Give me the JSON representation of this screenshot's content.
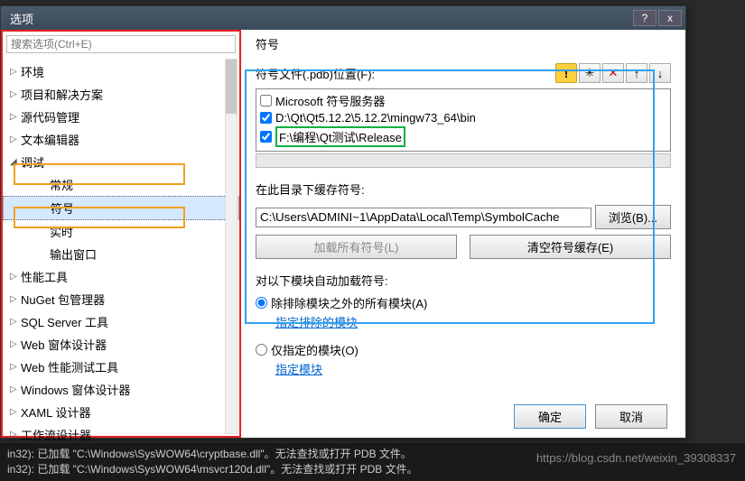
{
  "dialog": {
    "title": "选项"
  },
  "titlebar": {
    "help": "?",
    "close": "x"
  },
  "search": {
    "placeholder": "搜索选项(Ctrl+E)"
  },
  "tree": {
    "items": [
      {
        "label": "环境",
        "expandable": true
      },
      {
        "label": "项目和解决方案",
        "expandable": true
      },
      {
        "label": "源代码管理",
        "expandable": true
      },
      {
        "label": "文本编辑器",
        "expandable": true
      },
      {
        "label": "调试",
        "expandable": true,
        "expanded": true
      },
      {
        "label": "常规",
        "child": true
      },
      {
        "label": "符号",
        "child": true,
        "selected": true
      },
      {
        "label": "实时",
        "child": true
      },
      {
        "label": "输出窗口",
        "child": true
      },
      {
        "label": "性能工具",
        "expandable": true
      },
      {
        "label": "NuGet 包管理器",
        "expandable": true
      },
      {
        "label": "SQL Server 工具",
        "expandable": true
      },
      {
        "label": "Web 窗体设计器",
        "expandable": true
      },
      {
        "label": "Web 性能测试工具",
        "expandable": true
      },
      {
        "label": "Windows 窗体设计器",
        "expandable": true
      },
      {
        "label": "XAML 设计器",
        "expandable": true
      },
      {
        "label": "工作流设计器",
        "expandable": true
      }
    ]
  },
  "main": {
    "title": "符号",
    "loc_label": "符号文件(.pdb)位置(F):",
    "toolbar": {
      "warn": "!",
      "new": "✳",
      "del": "✕",
      "up": "↑",
      "down": "↓"
    },
    "locations": [
      {
        "checked": false,
        "text": "Microsoft 符号服务器"
      },
      {
        "checked": true,
        "text": "D:\\Qt\\Qt5.12.2\\5.12.2\\mingw73_64\\bin"
      },
      {
        "checked": true,
        "text": "F:\\编程\\Qt测试\\Release",
        "hl": true
      }
    ],
    "cache_label": "在此目录下缓存符号:",
    "cache_value": "C:\\Users\\ADMINI~1\\AppData\\Local\\Temp\\SymbolCache",
    "browse": "浏览(B)...",
    "load_all": "加载所有符号(L)",
    "clear_cache": "清空符号缓存(E)",
    "auto_label": "对以下模块自动加载符号:",
    "radio_exclude": "除排除模块之外的所有模块(A)",
    "link_exclude": "指定排除的模块",
    "radio_only": "仅指定的模块(O)",
    "link_only": "指定模块",
    "ok": "确定",
    "cancel": "取消"
  },
  "console": {
    "l1": "in32): 已加载 \"C:\\Windows\\SysWOW64\\cryptbase.dll\"。无法查找或打开 PDB 文件。",
    "l2": "in32): 已加载 \"C:\\Windows\\SysWOW64\\msvcr120d.dll\"。无法查找或打开 PDB 文件。"
  },
  "watermark": "https://blog.csdn.net/weixin_39308337"
}
